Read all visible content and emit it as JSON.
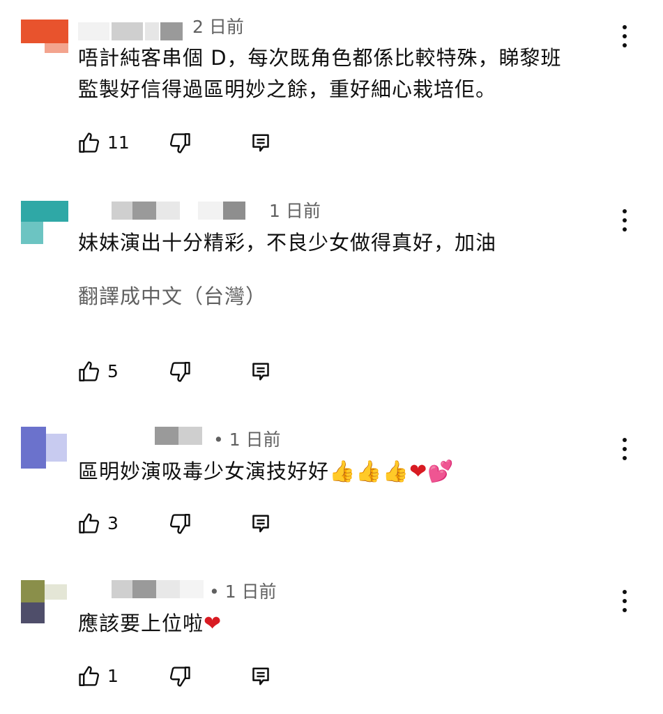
{
  "comments": [
    {
      "time": "2 日前",
      "lines": [
        "唔計純客串個 D，每次既角色都係比較特殊，睇黎班",
        "監製好信得過區明妙之餘，重好細心栽培佢。"
      ],
      "likes": "11",
      "avatar_color": "#e8532d"
    },
    {
      "time": "1 日前",
      "lines": [
        "妹妹演出十分精彩，不良少女做得真好，加油"
      ],
      "translate": "翻譯成中文（台灣）",
      "likes": "5",
      "avatar_color": "#2fa8a6"
    },
    {
      "time": "• 1 日前",
      "text": "區明妙演吸毒少女演技好好",
      "emojis": [
        "👍",
        "👍",
        "👍",
        "❤",
        "💕"
      ],
      "likes": "3",
      "avatar_color": "#6b72cc"
    },
    {
      "time": "• 1 日前",
      "text": "應該要上位啦",
      "emojis": [
        "❤"
      ],
      "likes": "1",
      "avatar_color": "#8a8f4a"
    }
  ],
  "icons": {
    "like": "thumbs-up-icon",
    "dislike": "thumbs-down-icon",
    "reply": "reply-icon",
    "more": "more-vertical-icon"
  }
}
